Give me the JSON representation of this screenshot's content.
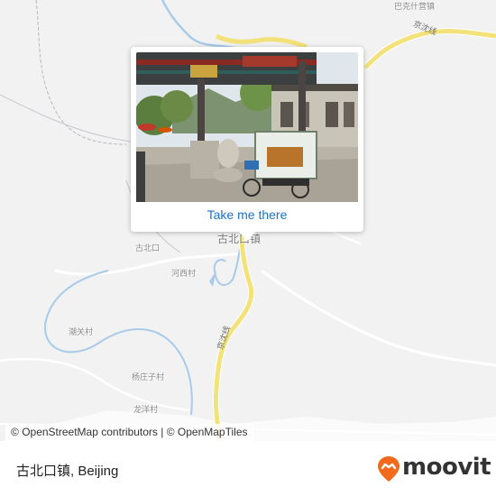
{
  "map": {
    "places": {
      "bakeshiying": "巴克什营镇",
      "gubeikou_top": "古北口",
      "gubeikou_town": "古北口镇",
      "hexicun": "河西村",
      "chaoguancun": "潮关村",
      "yangzhuangzicun": "杨庄子村",
      "longyangcun": "龙洋村"
    },
    "roads": {
      "jingshen_top": "京沈线",
      "jingshen_mid": "京沈线"
    },
    "colors": {
      "background": "#f1f2f1",
      "major_road": "#f3e27a",
      "river": "#a9cbea",
      "boundary": "#b8b8c2"
    }
  },
  "popup": {
    "photo_alt": "street scene",
    "link_label": "Take me there"
  },
  "attribution": {
    "prefix": "© ",
    "osm": "OpenStreetMap contributors",
    "sep": " | © ",
    "omt": "OpenMapTiles"
  },
  "footer": {
    "title": "古北口镇, Beijing",
    "brand": "moovit",
    "brand_color": "#f26b1d"
  }
}
